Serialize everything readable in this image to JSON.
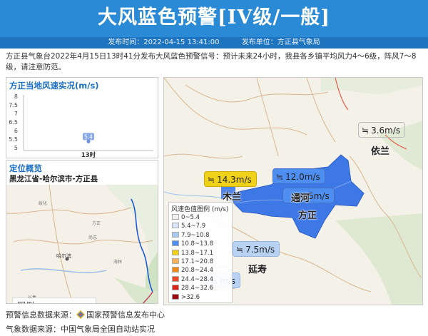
{
  "header": {
    "title": "大风蓝色预警[IV级/一般]"
  },
  "subbar": {
    "time": "发布时间：2022-04-15 13:41:00",
    "unit": "发布单位：方正县气象局"
  },
  "description": "方正县气象台2022年4月15日13时41分发布大风蓝色预警信号：预计未来24小时，我县各乡镇平均风力4～6级，阵风7～8级，请注意防范。",
  "wind_panel": {
    "title": "方正当地风速实况(m/s)",
    "y_ticks": [
      "8",
      "7.5",
      "7",
      "6.5",
      "6",
      "5.5",
      "5"
    ]
  },
  "chart_data": {
    "type": "scatter",
    "title": "方正当地风速实况(m/s)",
    "x": [
      "13时"
    ],
    "values": [
      5.4
    ],
    "ylim": [
      5,
      8
    ],
    "data_labels": [
      "5.4"
    ]
  },
  "location_panel": {
    "title": "定位概览",
    "location": "黑龙江省-哈尔滨市-方正县",
    "legend": {
      "title": "图例",
      "items": [
        {
          "label": "国界",
          "color": "#c24b6a"
        },
        {
          "label": "省界",
          "color": "#1e5bd8"
        }
      ]
    }
  },
  "map": {
    "tags": [
      {
        "value": "3.6m/s",
        "icon": "wind-icon",
        "bg": "#ffffff"
      },
      {
        "value": "14.3m/s",
        "icon": "wind-icon",
        "bg": "#f1d21a"
      },
      {
        "value": "12.0m/s",
        "icon": "wind-icon",
        "bg": "#4e8ef0"
      },
      {
        "value": "5m/s",
        "icon": "wind-icon",
        "bg": "#4e8ef0"
      },
      {
        "value": "7.5m/s",
        "icon": "wind-icon",
        "bg": "#b7d2f3"
      },
      {
        "value": "m/s",
        "icon": "wind-icon",
        "bg": "#b7d2f3"
      }
    ],
    "cities": [
      "依兰",
      "木兰",
      "通河",
      "方正",
      "延寿"
    ],
    "wind_legend": {
      "title": "风速色值图例 (m/s)",
      "items": [
        {
          "label": "0~5.4",
          "color": "#f2f2f2"
        },
        {
          "label": "5.4~7.9",
          "color": "#d6e6f8"
        },
        {
          "label": "7.9~10.8",
          "color": "#a9c9f0"
        },
        {
          "label": "10.8~13.8",
          "color": "#4e8ef0"
        },
        {
          "label": "13.8~17.1",
          "color": "#f3d11a"
        },
        {
          "label": "17.1~20.8",
          "color": "#f7b25a"
        },
        {
          "label": "20.8~24.4",
          "color": "#f08a16"
        },
        {
          "label": "24.4~28.4",
          "color": "#ec4b2a"
        },
        {
          "label": "28.4~32.6",
          "color": "#d6261c"
        },
        {
          "label": ">32.6",
          "color": "#9b0d12"
        }
      ]
    }
  },
  "footer": {
    "source1_label": "预警信息数据来源：",
    "source1_value": "国家预警信息发布中心",
    "source2": "气象数据来源：中国气象局全国自动站实况"
  }
}
